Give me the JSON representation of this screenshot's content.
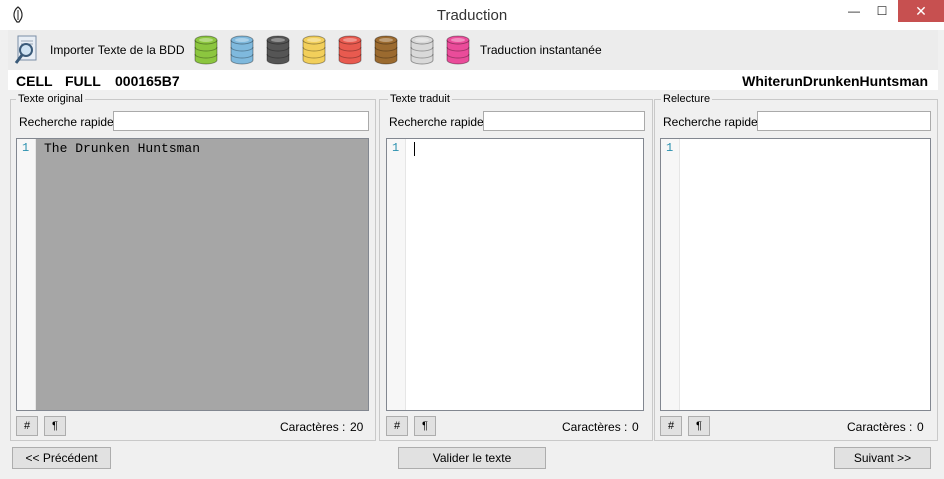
{
  "window": {
    "title": "Traduction",
    "min_glyph": "—",
    "max_glyph": "☐",
    "close_glyph": "✕"
  },
  "toolbar": {
    "import_label": "Importer Texte de la BDD",
    "instant_label": "Traduction instantanée",
    "db_icons": [
      {
        "name": "green-database-icon",
        "color": "#8cc63f"
      },
      {
        "name": "blue-database-icon",
        "color": "#7fb9dd"
      },
      {
        "name": "gray-database-icon",
        "color": "#555555"
      },
      {
        "name": "yellow-database-icon",
        "color": "#f2cf5b"
      },
      {
        "name": "red-database-icon",
        "color": "#e85a4f"
      },
      {
        "name": "brown-database-icon",
        "color": "#9b6a2f"
      },
      {
        "name": "lightgray-database-icon",
        "color": "#d9d9d9"
      },
      {
        "name": "pink-database-icon",
        "color": "#ea4c9a"
      }
    ]
  },
  "info": {
    "type": "CELL",
    "field": "FULL",
    "id": "000165B7",
    "editor_id": "WhiterunDrunkenHuntsman"
  },
  "panels": {
    "original": {
      "legend": "Texte original",
      "search_label": "Recherche rapide",
      "search_value": "",
      "line_number": "1",
      "text": "The Drunken Huntsman",
      "btn_hash": "#",
      "btn_pilcrow": "¶",
      "count_label": "Caractères :",
      "count_value": "20"
    },
    "translated": {
      "legend": "Texte traduit",
      "search_label": "Recherche rapide",
      "search_value": "",
      "line_number": "1",
      "text": "",
      "btn_hash": "#",
      "btn_pilcrow": "¶",
      "count_label": "Caractères :",
      "count_value": "0"
    },
    "review": {
      "legend": "Relecture",
      "search_label": "Recherche rapide",
      "search_value": "",
      "line_number": "1",
      "text": "",
      "btn_hash": "#",
      "btn_pilcrow": "¶",
      "count_label": "Caractères :",
      "count_value": "0"
    }
  },
  "footer": {
    "prev_label": "<< Précédent",
    "validate_label": "Valider le texte",
    "next_label": "Suivant >>"
  },
  "colors": {
    "accent_close": "#c75050",
    "line_number": "#2b91af",
    "original_editor_bg": "#a6a6a6"
  }
}
